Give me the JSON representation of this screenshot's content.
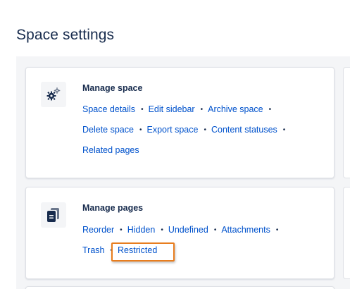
{
  "page": {
    "title": "Space settings"
  },
  "manage_space": {
    "heading": "Manage space",
    "icon": "gears-icon",
    "links": {
      "space_details": "Space details",
      "edit_sidebar": "Edit sidebar",
      "archive_space": "Archive space",
      "delete_space": "Delete space",
      "export_space": "Export space",
      "content_statuses": "Content statuses",
      "related_pages": "Related pages"
    },
    "separator": "•"
  },
  "manage_pages": {
    "heading": "Manage pages",
    "icon": "document-icon",
    "links": {
      "reorder": "Reorder",
      "hidden": "Hidden",
      "undefined": "Undefined",
      "attachments": "Attachments",
      "trash": "Trash",
      "restricted": "Restricted"
    },
    "separator": "•"
  },
  "colors": {
    "link": "#0052cc",
    "text": "#172b4d",
    "highlight": "#e87d1e",
    "background": "#f4f5f7"
  }
}
